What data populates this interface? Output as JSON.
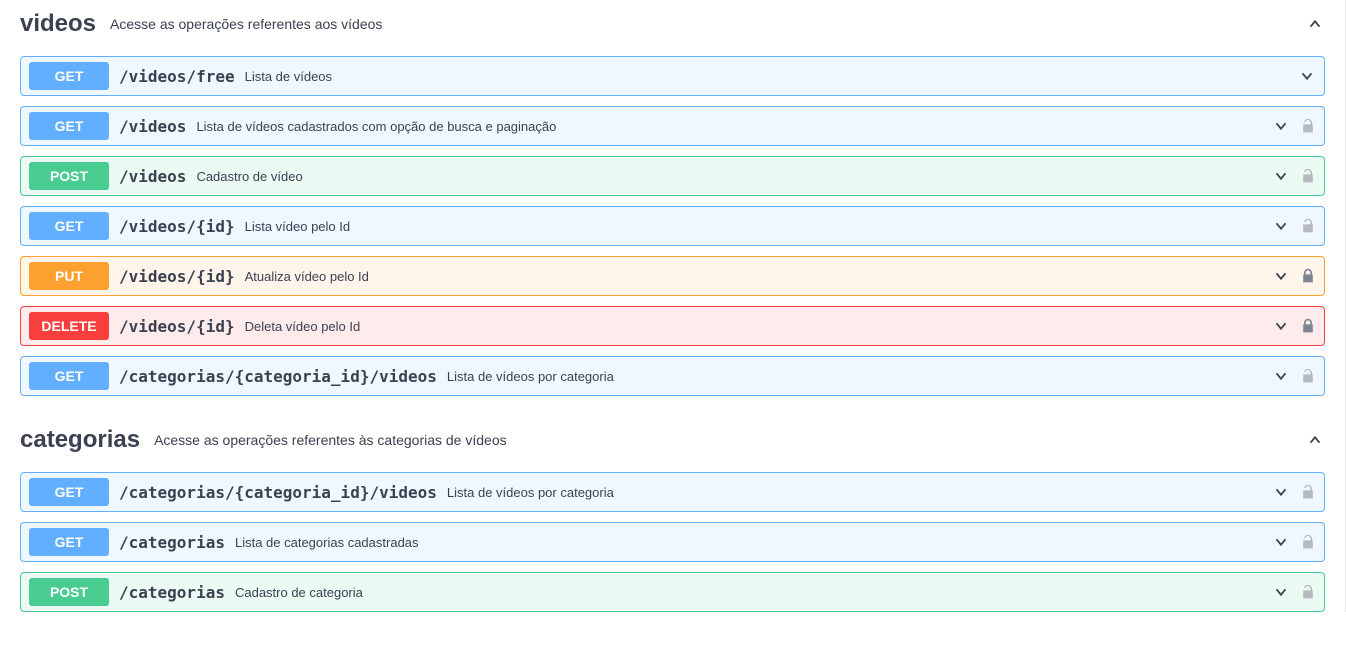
{
  "tags": [
    {
      "name": "videos",
      "description": "Acesse as operações referentes aos vídeos",
      "expanded": true,
      "ops": [
        {
          "method": "GET",
          "path": "/videos/free",
          "summary": "Lista de vídeos",
          "lock": null
        },
        {
          "method": "GET",
          "path": "/videos",
          "summary": "Lista de vídeos cadastrados com opção de busca e paginação",
          "lock": "unlocked"
        },
        {
          "method": "POST",
          "path": "/videos",
          "summary": "Cadastro de vídeo",
          "lock": "unlocked"
        },
        {
          "method": "GET",
          "path": "/videos/{id}",
          "summary": "Lista vídeo pelo Id",
          "lock": "unlocked"
        },
        {
          "method": "PUT",
          "path": "/videos/{id}",
          "summary": "Atualiza vídeo pelo Id",
          "lock": "locked"
        },
        {
          "method": "DELETE",
          "path": "/videos/{id}",
          "summary": "Deleta vídeo pelo Id",
          "lock": "locked"
        },
        {
          "method": "GET",
          "path": "/categorias/{categoria_id}/videos",
          "summary": "Lista de vídeos por categoria",
          "lock": "unlocked"
        }
      ]
    },
    {
      "name": "categorias",
      "description": "Acesse as operações referentes às categorias de vídeos",
      "expanded": true,
      "ops": [
        {
          "method": "GET",
          "path": "/categorias/{categoria_id}/videos",
          "summary": "Lista de vídeos por categoria",
          "lock": "unlocked"
        },
        {
          "method": "GET",
          "path": "/categorias",
          "summary": "Lista de categorias cadastradas",
          "lock": "unlocked"
        },
        {
          "method": "POST",
          "path": "/categorias",
          "summary": "Cadastro de categoria",
          "lock": "unlocked"
        }
      ]
    }
  ]
}
